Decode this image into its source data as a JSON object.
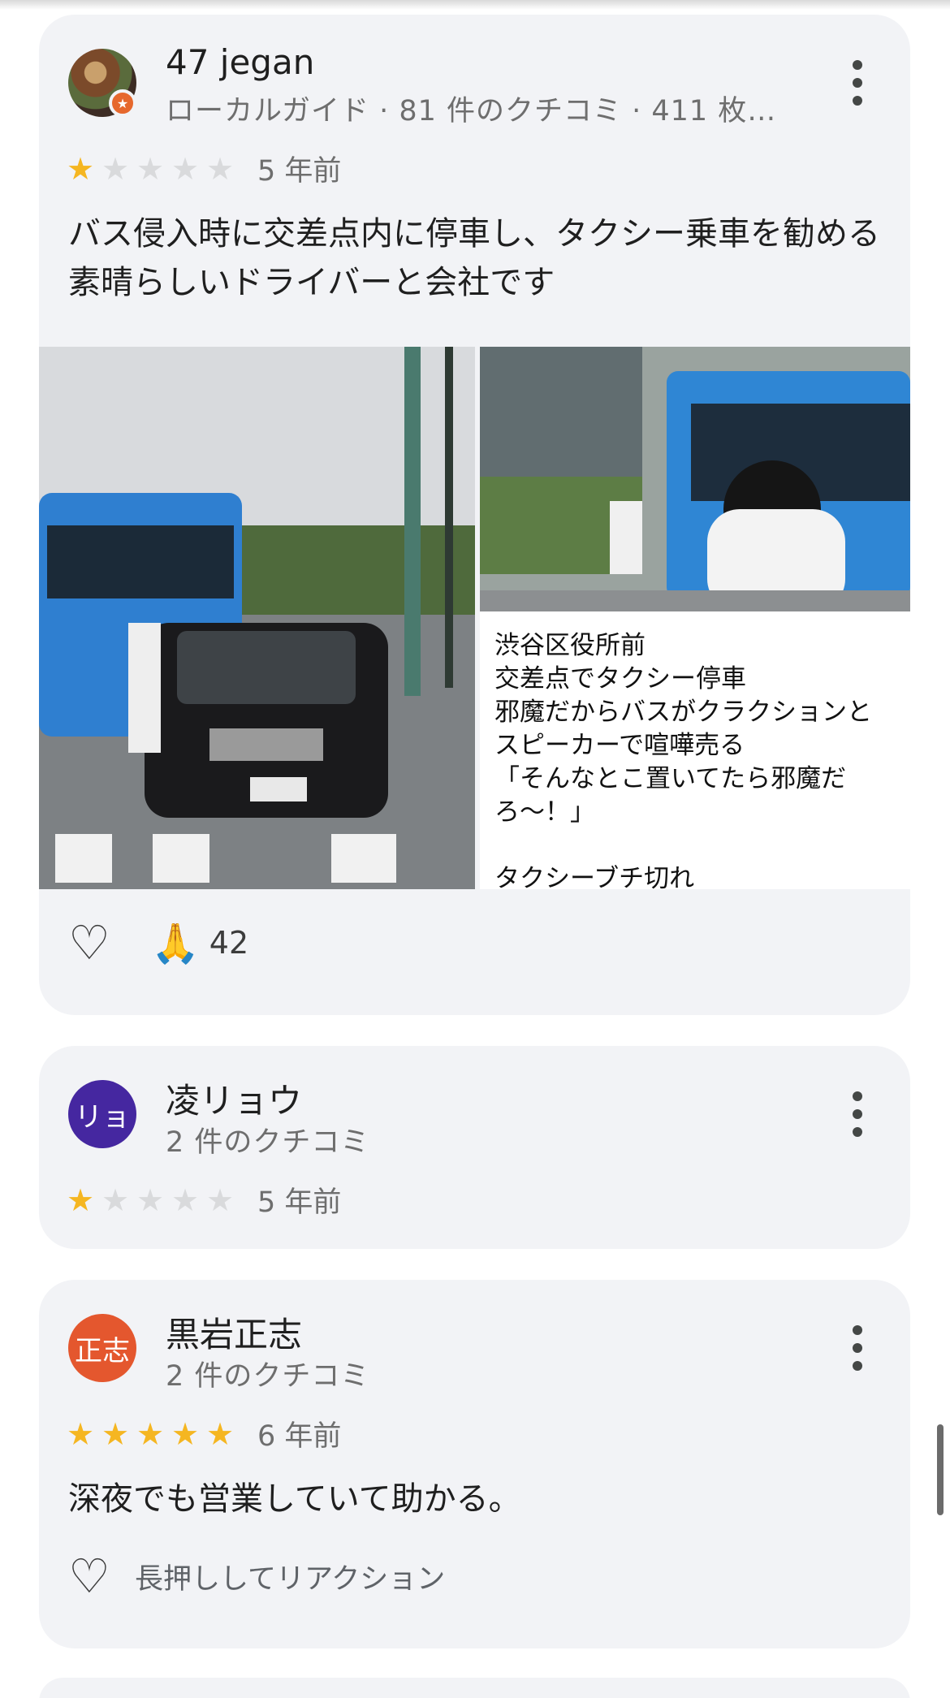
{
  "reviews": [
    {
      "name": "47 jegan",
      "subtitle": "ローカルガイド · 81 件のクチコミ · 411 枚…",
      "stars": 1,
      "time_ago": "5 年前",
      "text": "バス侵入時に交差点内に停車し、タクシー乗車を勧める素晴らしいドライバーと会社です",
      "photo_caption": "渋谷区役所前\n交差点でタクシー停車\n邪魔だからバスがクラクションと\nスピーカーで喧嘩売る\n「そんなとこ置いてたら邪魔だ\nろ〜！」\n\nタクシーブチ切れ",
      "reaction_emoji": "🙏",
      "reaction_count": "42"
    },
    {
      "name": "凌リョウ",
      "avatar_text": "リョ",
      "avatar_color": "#4527a0",
      "subtitle": "2 件のクチコミ",
      "stars": 1,
      "time_ago": "5 年前"
    },
    {
      "name": "黒岩正志",
      "avatar_text": "正志",
      "avatar_color": "#e4572e",
      "subtitle": "2 件のクチコミ",
      "stars": 5,
      "time_ago": "6 年前",
      "text": "深夜でも営業していて助かる。",
      "reaction_hint": "長押ししてリアクション"
    }
  ],
  "icons": {
    "heart": "heart-outline-icon",
    "more": "more-vert-icon",
    "star": "star-icon"
  },
  "colors": {
    "star_on": "#f5b621",
    "star_off": "#d9dadc",
    "card_bg": "#f2f3f6"
  }
}
